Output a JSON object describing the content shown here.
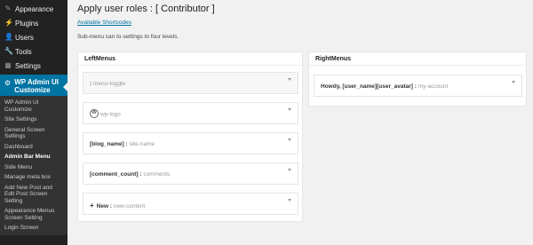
{
  "sidebar": {
    "items": [
      {
        "label": "Appearance",
        "icon": "paintbrush-icon"
      },
      {
        "label": "Plugins",
        "icon": "plugin-icon"
      },
      {
        "label": "Users",
        "icon": "users-icon"
      },
      {
        "label": "Tools",
        "icon": "wrench-icon"
      },
      {
        "label": "Settings",
        "icon": "settings-icon"
      }
    ],
    "current": {
      "label": "WP Admin UI Customize",
      "icon": "gear-icon"
    },
    "submenu": [
      "WP Admin UI Customize",
      "Site Settings",
      "General Screen Settings",
      "Dashboard",
      "Admin Bar Menu",
      "Side Menu",
      "Manage meta box",
      "Add New Post and Edit Post Screen Setting",
      "Appearance Menus Screen Setting",
      "Login Screen"
    ],
    "active_submenu": "Admin Bar Menu"
  },
  "main": {
    "title": "Apply user roles : [ Contributor ]",
    "shortcodes_link": "Available Shortcodes",
    "description": "Sub-menu can to settings to four levels.",
    "left_panel": {
      "heading": "LeftMenus",
      "menus": [
        {
          "key": ":",
          "id": "menu-toggle"
        },
        {
          "key": "",
          "id": "wp-logo"
        },
        {
          "key": "[blog_name] :",
          "id": "site-name"
        },
        {
          "key": "[comment_count] :",
          "id": "comments"
        },
        {
          "key": "New :",
          "id": "new-content"
        }
      ]
    },
    "right_panel": {
      "heading": "RightMenus",
      "menus": [
        {
          "key": "Howdy, [user_name][user_avatar] :",
          "id": "my-account"
        }
      ]
    }
  }
}
